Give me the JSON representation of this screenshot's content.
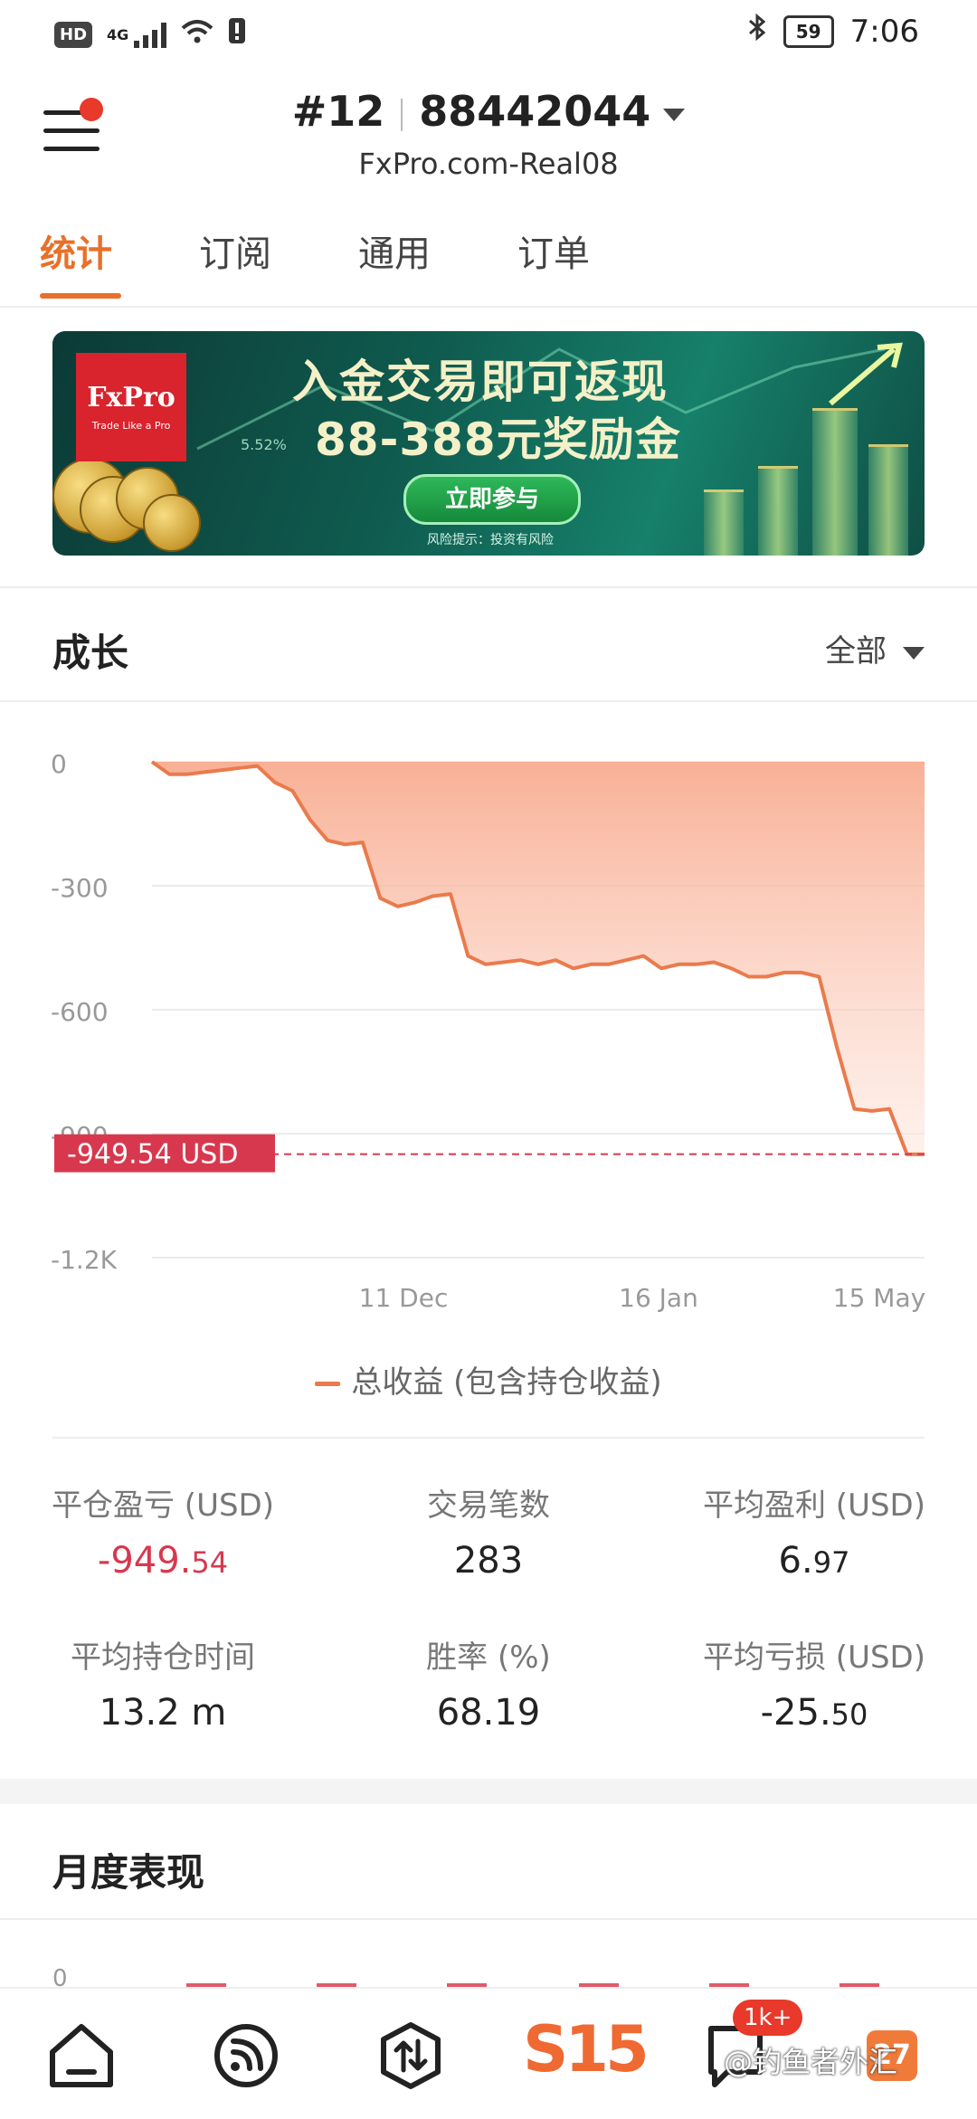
{
  "status_bar": {
    "hd": "HD",
    "network": "4G",
    "battery": "59",
    "time": "7:06"
  },
  "header": {
    "account_number": "#12",
    "account_id": "88442044",
    "server": "FxPro.com-Real08"
  },
  "tabs": [
    {
      "label": "统计",
      "active": true
    },
    {
      "label": "订阅",
      "active": false
    },
    {
      "label": "通用",
      "active": false
    },
    {
      "label": "订单",
      "active": false
    }
  ],
  "banner": {
    "logo_text": "FxPro",
    "logo_slogan": "Trade Like a Pro",
    "percent": "5.52%",
    "headline1": "入金交易即可返现",
    "headline2": "88-388元奖励金",
    "cta": "立即参与",
    "risk_note": "风险提示：投资有风险"
  },
  "growth": {
    "title": "成长",
    "filter": "全部",
    "current_label": "-949.54 USD",
    "legend": "总收益 (包含持仓收益)"
  },
  "chart_data": {
    "type": "area",
    "series": [
      {
        "name": "总收益 (包含持仓收益)",
        "values": [
          0,
          -30,
          -30,
          -25,
          -20,
          -15,
          -10,
          -50,
          -70,
          -140,
          -190,
          -200,
          -195,
          -330,
          -350,
          -340,
          -325,
          -320,
          -470,
          -490,
          -485,
          -480,
          -490,
          -480,
          -500,
          -490,
          -490,
          -480,
          -470,
          -500,
          -490,
          -490,
          -485,
          -500,
          -520,
          -520,
          -510,
          -510,
          -520,
          -690,
          -840,
          -845,
          -840,
          -950,
          -950
        ]
      }
    ],
    "x_ticks": [
      "11 Dec",
      "16 Jan",
      "15 May"
    ],
    "y_ticks": [
      "0",
      "-300",
      "-600",
      "-900",
      "-1.2K"
    ],
    "ylim": [
      -1200,
      0
    ],
    "current_value": -949.54,
    "grid": true,
    "legend_position": "bottom",
    "line_color": "#ea7a4c"
  },
  "stats": [
    {
      "label": "平仓盈亏 (USD)",
      "main": "-949.",
      "small": "54",
      "negative": true
    },
    {
      "label": "交易笔数",
      "main": "283",
      "small": "",
      "negative": false
    },
    {
      "label": "平均盈利 (USD)",
      "main": "6.",
      "small": "97",
      "negative": false
    },
    {
      "label": "平均持仓时间",
      "main": "13.2 m",
      "small": "",
      "negative": false
    },
    {
      "label": "胜率 (%)",
      "main": "68.19",
      "small": "",
      "negative": false
    },
    {
      "label": "平均亏损 (USD)",
      "main": "-25.",
      "small": "50",
      "negative": false
    }
  ],
  "monthly": {
    "title": "月度表现",
    "zero_tick": "0"
  },
  "bottom_nav": {
    "brand": "S15",
    "badge": "1k+",
    "corner_badge": "27",
    "watermark": "@钓鱼者外汇"
  }
}
